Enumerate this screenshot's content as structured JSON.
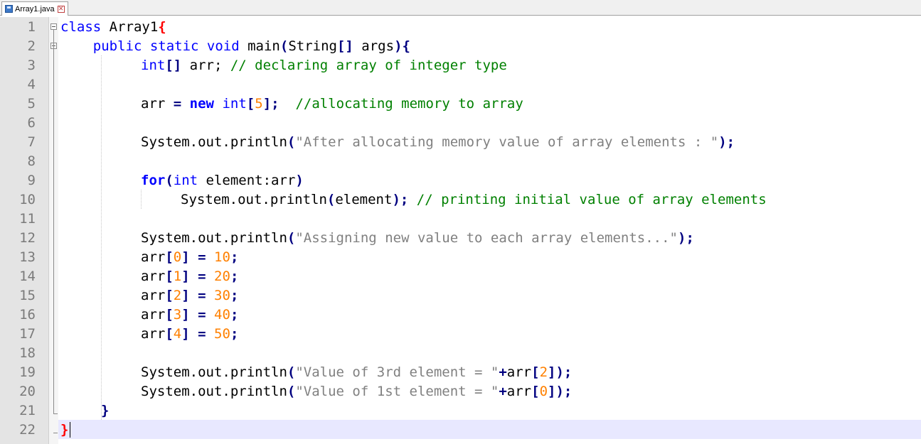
{
  "tab": {
    "title": "Array1.java"
  },
  "lines": [
    {
      "n": "1",
      "t": [
        [
          "kw",
          "class"
        ],
        [
          "",
          "class"
        ],
        [
          "",
          "Array1"
        ],
        [
          "brr",
          "{"
        ]
      ]
    },
    {
      "n": "2"
    },
    {
      "n": "3"
    },
    {
      "n": "4"
    },
    {
      "n": "5"
    },
    {
      "n": "6"
    },
    {
      "n": "7"
    },
    {
      "n": "8"
    },
    {
      "n": "9"
    },
    {
      "n": "10"
    },
    {
      "n": "11"
    },
    {
      "n": "12"
    },
    {
      "n": "13"
    },
    {
      "n": "14"
    },
    {
      "n": "15"
    },
    {
      "n": "16"
    },
    {
      "n": "17"
    },
    {
      "n": "18"
    },
    {
      "n": "19"
    },
    {
      "n": "20"
    },
    {
      "n": "21"
    },
    {
      "n": "22"
    }
  ],
  "code": {
    "l1_kw": "class",
    "l1_name": " Array1",
    "l1_brace": "{",
    "l2_a": "    ",
    "l2_kw": "public static void",
    "l2_b": " main",
    "l2_p1": "(",
    "l2_c": "String",
    "l2_br": "[]",
    "l2_d": " args",
    "l2_p2": ")",
    "l2_brace": "{",
    "l3_kw": "int",
    "l3_br": "[]",
    "l3_a": " arr; ",
    "l3_cm": "// declaring array of integer type",
    "l5_a": "arr ",
    "l5_eq": "=",
    "l5_sp": " ",
    "l5_new": "new",
    "l5_sp2": " ",
    "l5_int": "int",
    "l5_b1": "[",
    "l5_n": "5",
    "l5_b2": "];",
    "l5_sp3": "  ",
    "l5_cm": "//allocating memory to array",
    "l7_a": "System.out.println",
    "l7_p1": "(",
    "l7_s": "\"After allocating memory value of array elements : \"",
    "l7_p2": ");",
    "l9_for": "for",
    "l9_p1": "(",
    "l9_int": "int",
    "l9_a": " element:arr",
    "l9_p2": ")",
    "l10_a": "System.out.println",
    "l10_p1": "(",
    "l10_b": "element",
    "l10_p2": ");",
    "l10_sp": " ",
    "l10_cm": "// printing initial value of array elements",
    "l12_a": "System.out.println",
    "l12_p1": "(",
    "l12_s": "\"Assigning new value to each array elements...\"",
    "l12_p2": ");",
    "assign": [
      {
        "idx": "0",
        "val": "10"
      },
      {
        "idx": "1",
        "val": "20"
      },
      {
        "idx": "2",
        "val": "30"
      },
      {
        "idx": "3",
        "val": "40"
      },
      {
        "idx": "4",
        "val": "50"
      }
    ],
    "arr": "arr",
    "lb": "[",
    "rb": "]",
    "eq": " = ",
    "semi": ";",
    "l19_a": "System.out.println",
    "l19_p1": "(",
    "l19_s": "\"Value of 3rd element = \"",
    "l19_plus": "+",
    "l19_b": "arr",
    "l19_lb": "[",
    "l19_n": "2",
    "l19_rb": "]",
    "l19_p2": ");",
    "l20_a": "System.out.println",
    "l20_p1": "(",
    "l20_s": "\"Value of 1st element = \"",
    "l20_plus": "+",
    "l20_b": "arr",
    "l20_lb": "[",
    "l20_n": "0",
    "l20_rb": "]",
    "l20_p2": ");",
    "l21_brace": "}",
    "l22_brace": "}"
  },
  "line_numbers": [
    "1",
    "2",
    "3",
    "4",
    "5",
    "6",
    "7",
    "8",
    "9",
    "10",
    "11",
    "12",
    "13",
    "14",
    "15",
    "16",
    "17",
    "18",
    "19",
    "20",
    "21",
    "22"
  ],
  "colors": {
    "keyword": "#0000ff",
    "comment": "#008000",
    "string": "#808080",
    "number": "#ff8000",
    "current_line": "#e8e8ff"
  }
}
